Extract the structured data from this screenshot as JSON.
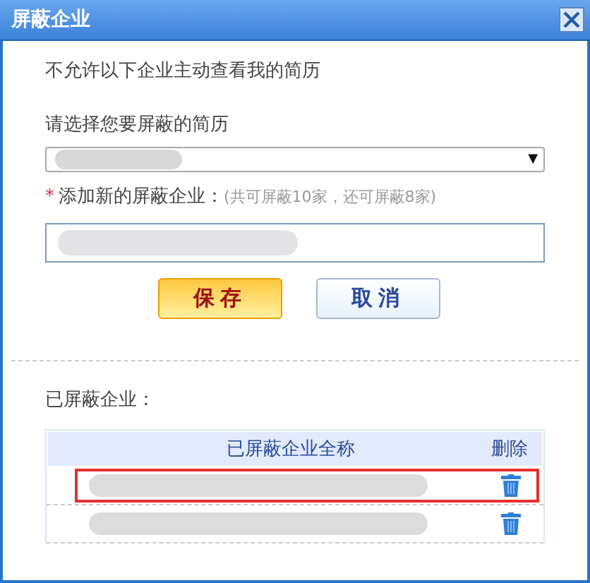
{
  "window": {
    "title": "屏蔽企业"
  },
  "intro": "不允许以下企业主动查看我的简历",
  "resume_select": {
    "label": "请选择您要屏蔽的简历",
    "arrow": "▼"
  },
  "add_field": {
    "required_mark": "*",
    "label": "添加新的屏蔽企业：",
    "hint": "(共可屏蔽10家，还可屏蔽8家)"
  },
  "buttons": [
    {
      "label": "保存",
      "kind": "primary"
    },
    {
      "label": "取消",
      "kind": "secondary"
    }
  ],
  "blocked": {
    "label": "已屏蔽企业：",
    "columns": [
      "已屏蔽企业全称",
      "删除"
    ],
    "rows": [
      {
        "highlighted": true
      },
      {
        "highlighted": false
      }
    ]
  }
}
